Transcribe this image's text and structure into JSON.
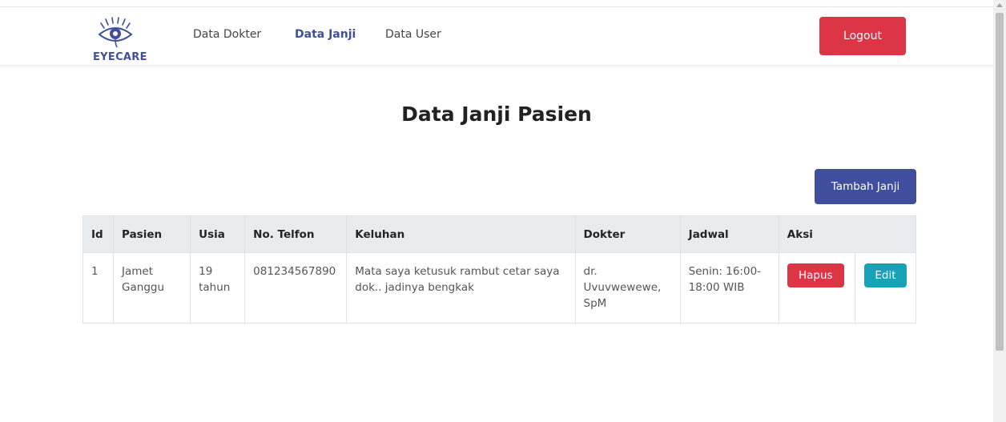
{
  "brand": {
    "name": "EYECARE",
    "logo_icon": "eye-icon",
    "color": "#3f4f9e"
  },
  "nav": {
    "items": [
      {
        "label": "Data Dokter",
        "active": false
      },
      {
        "label": "Data Janji",
        "active": true
      },
      {
        "label": "Data User",
        "active": false
      }
    ],
    "logout_label": "Logout"
  },
  "main": {
    "title": "Data Janji Pasien",
    "add_button_label": "Tambah Janji"
  },
  "table": {
    "headers": [
      "Id",
      "Pasien",
      "Usia",
      "No. Telfon",
      "Keluhan",
      "Dokter",
      "Jadwal",
      "Aksi"
    ],
    "rows": [
      {
        "id": "1",
        "pasien": "Jamet Ganggu",
        "usia": "19 tahun",
        "telfon": "081234567890",
        "keluhan": "Mata saya ketusuk rambut cetar saya dok.. jadinya bengkak",
        "dokter": "dr. Uvuvwewewe, SpM",
        "jadwal": "Senin: 16:00-18:00 WIB",
        "hapus_label": "Hapus",
        "edit_label": "Edit"
      }
    ]
  },
  "colors": {
    "primary": "#3f4f9e",
    "danger": "#dc3545",
    "info": "#17a2b8",
    "header_bg": "#e9ecef"
  }
}
